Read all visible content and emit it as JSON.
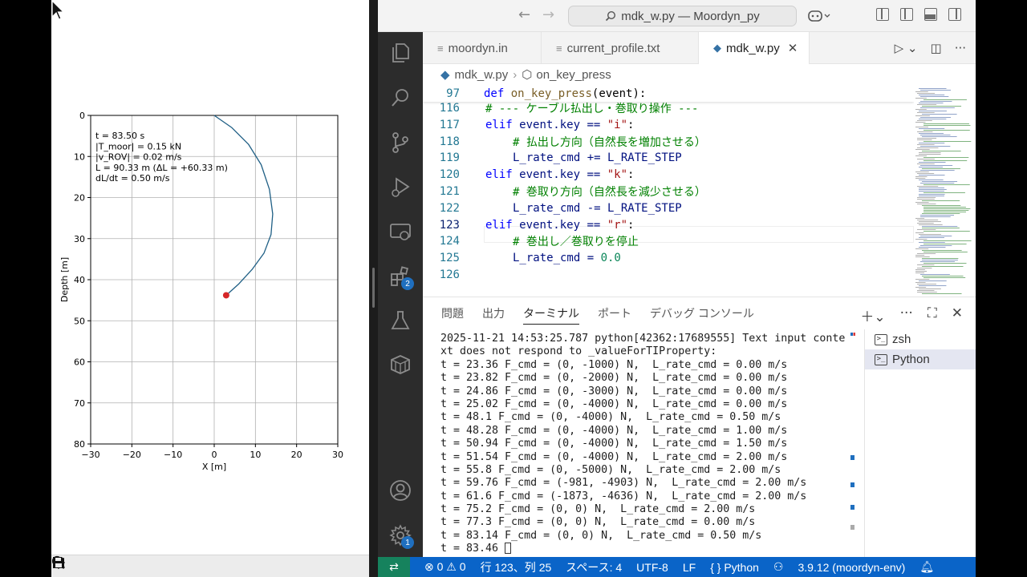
{
  "plot": {
    "info": {
      "t": "t = 83.50 s",
      "tmoor": "|T_moor| =   0.15 kN",
      "vrov": "|v_ROV| =   0.02 m/s",
      "L": "L =  90.33 m (ΔL = +60.33 m)",
      "dldt": "dL/dt =  0.50 m/s"
    },
    "colors": {
      "cable": "#1f5f85",
      "rov": "#d62728"
    }
  },
  "chart_data": {
    "type": "line",
    "xlabel": "X [m]",
    "ylabel": "Depth [m]",
    "xlim": [
      -30,
      30
    ],
    "ylim": [
      80,
      0
    ],
    "x_ticks": [
      "−30",
      "−20",
      "−10",
      "0",
      "10",
      "20",
      "30"
    ],
    "y_ticks": [
      "0",
      "10",
      "20",
      "30",
      "40",
      "50",
      "60",
      "70",
      "80"
    ],
    "grid": true,
    "series": [
      {
        "x": [
          0,
          4.3,
          8.3,
          11.4,
          13.4,
          14.2,
          13.8,
          12.1,
          9.2,
          6.0,
          2.9
        ],
        "y": [
          0,
          3,
          7,
          12,
          18,
          24,
          29,
          33.5,
          37.5,
          41,
          43.8
        ]
      }
    ],
    "points": [
      {
        "x": 2.9,
        "y": 43.8
      }
    ]
  },
  "toolbar": [
    "home-icon",
    "back-icon",
    "forward-icon",
    "pan-icon",
    "zoom-icon",
    "configure-icon",
    "save-icon"
  ],
  "window": {
    "title": "mdk_w.py — Moordyn_py"
  },
  "tabs": [
    {
      "label": "moordyn.in"
    },
    {
      "label": "current_profile.txt"
    },
    {
      "label": "mdk_w.py"
    }
  ],
  "breadcrumb": {
    "file": "mdk_w.py",
    "symbol": "on_key_press"
  },
  "editor": {
    "sticky": {
      "num": "97",
      "kw": "def",
      "fn": "on_key_press",
      "rest": "(event):"
    },
    "lines": [
      {
        "num": "116",
        "text": "# --- ケーブル払出し・巻取り操作 ---"
      },
      {
        "num": "117",
        "kw": "elif",
        "a": "event.key == ",
        "s": "\"i\"",
        "b": ":"
      },
      {
        "num": "118",
        "text": "# 払出し方向（自然長を増加させる）"
      },
      {
        "num": "119",
        "a": "L_rate_cmd += L_RATE_STEP"
      },
      {
        "num": "120",
        "kw": "elif",
        "a": "event.key == ",
        "s": "\"k\"",
        "b": ":"
      },
      {
        "num": "121",
        "text": "# 巻取り方向（自然長を減少させる）"
      },
      {
        "num": "122",
        "a": "L_rate_cmd -= L_RATE_STEP"
      },
      {
        "num": "123",
        "kw": "elif",
        "a": "event.key == ",
        "s": "\"r\"",
        "b": ":"
      },
      {
        "num": "124",
        "text": "# 巻出し／巻取りを停止"
      },
      {
        "num": "125",
        "a": "L_rate_cmd = ",
        "n": "0.0"
      },
      {
        "num": "126"
      }
    ]
  },
  "panel": {
    "tabs": [
      "問題",
      "出力",
      "ターミナル",
      "ポート",
      "デバッグ コンソール"
    ],
    "terminal_lines": [
      "2025-11-21 14:53:25.787 python[42362:17689555] Text input conte",
      "xt does not respond to _valueForTIProperty:",
      "t = 23.36 F_cmd = (0, -1000) N,  L_rate_cmd = 0.00 m/s",
      "t = 23.82 F_cmd = (0, -2000) N,  L_rate_cmd = 0.00 m/s",
      "t = 24.86 F_cmd = (0, -3000) N,  L_rate_cmd = 0.00 m/s",
      "t = 25.02 F_cmd = (0, -4000) N,  L_rate_cmd = 0.00 m/s",
      "t = 48.1 F_cmd = (0, -4000) N,  L_rate_cmd = 0.50 m/s",
      "t = 48.28 F_cmd = (0, -4000) N,  L_rate_cmd = 1.00 m/s",
      "t = 50.94 F_cmd = (0, -4000) N,  L_rate_cmd = 1.50 m/s",
      "t = 51.54 F_cmd = (0, -4000) N,  L_rate_cmd = 2.00 m/s",
      "t = 55.8 F_cmd = (0, -5000) N,  L_rate_cmd = 2.00 m/s",
      "t = 59.76 F_cmd = (-981, -4903) N,  L_rate_cmd = 2.00 m/s",
      "t = 61.6 F_cmd = (-1873, -4636) N,  L_rate_cmd = 2.00 m/s",
      "t = 75.2 F_cmd = (0, 0) N,  L_rate_cmd = 2.00 m/s",
      "t = 77.3 F_cmd = (0, 0) N,  L_rate_cmd = 0.00 m/s",
      "t = 83.14 F_cmd = (0, 0) N,  L_rate_cmd = 0.50 m/s"
    ],
    "prompt": "t = 83.46 ",
    "terminals": [
      "zsh",
      "Python"
    ]
  },
  "status": {
    "errors": "0",
    "warnings": "0",
    "position": "行 123、列 25",
    "spaces": "スペース: 4",
    "encoding": "UTF-8",
    "eol": "LF",
    "language": "Python",
    "interpreter": "3.9.12 (moordyn-env)"
  },
  "activity_badges": {
    "extensions": "2",
    "settings": "1"
  }
}
